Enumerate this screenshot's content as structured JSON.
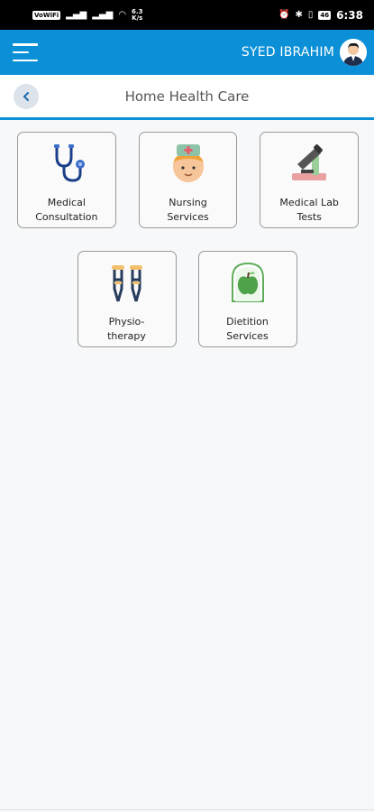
{
  "status_bar": {
    "vowifi": "VoWiFi",
    "speed_value": "6.3",
    "speed_unit": "K/s",
    "battery": "46",
    "time": "6:38"
  },
  "app_bar": {
    "user_name": "SYED IBRAHIM",
    "color": "#0b8fd6"
  },
  "header": {
    "title": "Home Health Care"
  },
  "services": [
    {
      "label": "Medical\nConsultation",
      "icon": "stethoscope-icon"
    },
    {
      "label": "Nursing\nServices",
      "icon": "nurse-icon"
    },
    {
      "label": "Medical Lab\nTests",
      "icon": "microscope-icon"
    },
    {
      "label": "Physio-\ntherapy",
      "icon": "crutches-icon"
    },
    {
      "label": "Dietition\nServices",
      "icon": "apple-icon"
    }
  ]
}
